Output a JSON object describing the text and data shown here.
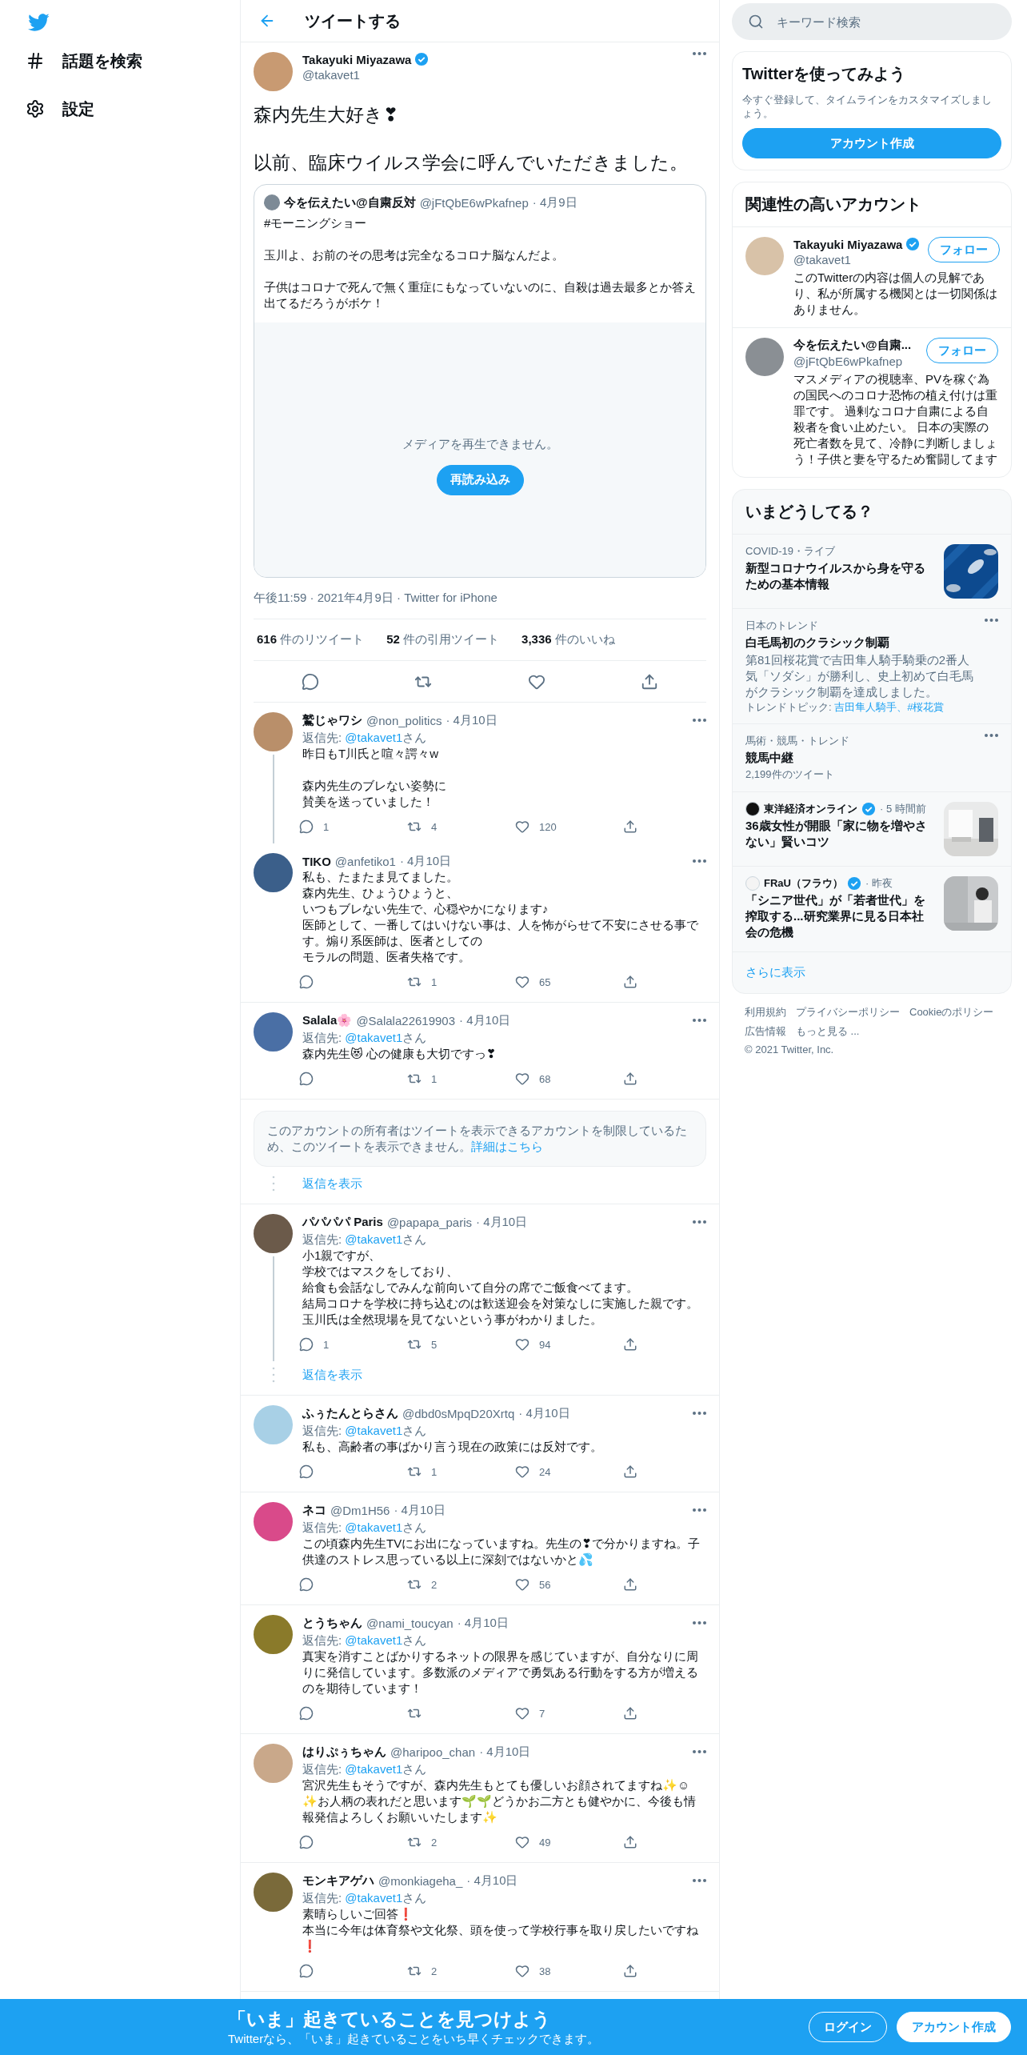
{
  "nav": {
    "items": [
      {
        "kind": "hash",
        "label": "話題を検索"
      },
      {
        "kind": "gear",
        "label": "設定"
      }
    ]
  },
  "header": {
    "title": "ツイートする"
  },
  "tweet": {
    "name": "Takayuki Miyazawa",
    "verified": true,
    "handle": "@takavet1",
    "text": [
      [
        "森内先生大好き❣"
      ],
      [
        "以前、臨床ウイルス学会に呼んでいただきました。"
      ]
    ],
    "quote": {
      "name": "今を伝えたい@自粛反対",
      "handle": "@jFtQbE6wPkafnep",
      "date": "· 4月9日",
      "text": [
        [
          "#モーニングショー"
        ],
        [
          "玉川よ、お前のその思考は完全なるコロナ脳なんだよ。"
        ],
        [
          "子供はコロナで死んで無く重症にもなっていないのに、自殺は過去最多とか答え出てるだろうがボケ！"
        ]
      ],
      "media_message": "メディアを再生できません。",
      "reload_button": "再読み込み"
    },
    "meta": "午後11:59 · 2021年4月9日 · Twitter for iPhone",
    "stats": [
      {
        "count": "616",
        "label": "件のリツイート"
      },
      {
        "count": "52",
        "label": "件の引用ツイート"
      },
      {
        "count": "3,336",
        "label": "件のいいね"
      }
    ]
  },
  "replies": [
    {
      "kind": "tweet",
      "name": "鷲じゃワシ",
      "handle": "@non_politics",
      "date": "· 4月10日",
      "reply_to": {
        "prefix": "返信先: ",
        "handle": "@takavet1",
        "suffix": "さん"
      },
      "text": [
        [
          "昨日もT川氏と喧々諤々w"
        ],
        [
          "森内先生のブレない姿勢に",
          "賛美を送っていました！"
        ]
      ],
      "replies": "1",
      "retweets": "4",
      "likes": "120",
      "thread": true
    },
    {
      "kind": "tweet",
      "name": "TIKO",
      "handle": "@anfetiko1",
      "date": "· 4月10日",
      "text": [
        [
          "私も、たまたま見てました。",
          "森内先生、ひょうひょうと、",
          "いつもブレない先生で、心穏やかになります♪",
          "医師として、一番してはいけない事は、人を怖がらせて不安にさせる事です。煽り系医師は、医者としての",
          "モラルの問題、医者失格です。"
        ]
      ],
      "retweets": "1",
      "likes": "65",
      "thread": false
    },
    {
      "kind": "tweet",
      "name": "Salala🌸",
      "handle": "@Salala22619903",
      "date": "· 4月10日",
      "reply_to": {
        "prefix": "返信先: ",
        "handle": "@takavet1",
        "suffix": "さん"
      },
      "text": [
        [
          "森内先生😻 心の健康も大切ですっ❣"
        ]
      ],
      "retweets": "1",
      "likes": "68",
      "thread": false
    },
    {
      "kind": "notice",
      "text": "このアカウントの所有者はツイートを表示できるアカウントを制限しているため、このツイートを表示できません。",
      "link": "詳細はこちら"
    },
    {
      "kind": "show_replies",
      "label": "返信を表示"
    },
    {
      "kind": "tweet",
      "name": "パパパパ Paris",
      "handle": "@papapa_paris",
      "date": "· 4月10日",
      "reply_to": {
        "prefix": "返信先: ",
        "handle": "@takavet1",
        "suffix": "さん"
      },
      "text": [
        [
          "小1親ですが、",
          "学校ではマスクをしており、",
          "給食も会話なしでみんな前向いて自分の席でご飯食べてます。",
          "結局コロナを学校に持ち込むのは歓送迎会を対策なしに実施した親です。",
          "玉川氏は全然現場を見てないという事がわかりました。"
        ]
      ],
      "replies": "1",
      "retweets": "5",
      "likes": "94",
      "thread": true
    },
    {
      "kind": "show_replies",
      "label": "返信を表示"
    },
    {
      "kind": "tweet",
      "name": "ふぅたんとらさん",
      "handle": "@dbd0sMpqD20Xrtq",
      "date": "· 4月10日",
      "reply_to": {
        "prefix": "返信先: ",
        "handle": "@takavet1",
        "suffix": "さん"
      },
      "text": [
        [
          "私も、高齢者の事ばかり言う現在の政策には反対です。"
        ]
      ],
      "retweets": "1",
      "likes": "24",
      "thread": false
    },
    {
      "kind": "tweet",
      "name": "ネコ",
      "handle": "@Dm1H56",
      "date": "· 4月10日",
      "reply_to": {
        "prefix": "返信先: ",
        "handle": "@takavet1",
        "suffix": "さん"
      },
      "text": [
        [
          "この頃森内先生TVにお出になっていますね。先生の❣で分かりますね。子供達のストレス思っている以上に深刻ではないかと💦"
        ]
      ],
      "retweets": "2",
      "likes": "56",
      "thread": false
    },
    {
      "kind": "tweet",
      "name": "とうちゃん",
      "handle": "@nami_toucyan",
      "date": "· 4月10日",
      "reply_to": {
        "prefix": "返信先: ",
        "handle": "@takavet1",
        "suffix": "さん"
      },
      "text": [
        [
          "真実を消すことばかりするネットの限界を感じていますが、自分なりに周りに発信しています。多数派のメディアで勇気ある行動をする方が増えるのを期待しています！"
        ]
      ],
      "likes": "7",
      "thread": false
    },
    {
      "kind": "tweet",
      "name": "はりぷぅちゃん",
      "handle": "@haripoo_chan",
      "date": "· 4月10日",
      "reply_to": {
        "prefix": "返信先: ",
        "handle": "@takavet1",
        "suffix": "さん"
      },
      "text": [
        [
          "宮沢先生もそうですが、森内先生もとても優しいお顔されてますね✨☺",
          "✨お人柄の表れだと思います🌱🌱どうかお二方とも健やかに、今後も情報発信よろしくお願いいたします✨"
        ]
      ],
      "retweets": "2",
      "likes": "49",
      "thread": false
    },
    {
      "kind": "tweet",
      "name": "モンキアゲハ",
      "handle": "@monkiageha_",
      "date": "· 4月10日",
      "reply_to": {
        "prefix": "返信先: ",
        "handle": "@takavet1",
        "suffix": "さん"
      },
      "text": [
        [
          "素晴らしいご回答❗",
          "本当に今年は体育祭や文化祭、頭を使って学校行事を取り戻したいですね❗"
        ]
      ],
      "retweets": "2",
      "likes": "38",
      "thread": false
    }
  ],
  "sidebar": {
    "search": {
      "placeholder": "キーワード検索"
    },
    "signup": {
      "title": "Twitterを使ってみよう",
      "text": "今すぐ登録して、タイムラインをカスタマイズしましょう。",
      "button": "アカウント作成"
    },
    "related": {
      "title": "関連性の高いアカウント",
      "accounts": [
        {
          "name": "Takayuki Miyazawa",
          "verified": true,
          "handle": "@takavet1",
          "bio": "このTwitterの内容は個人の見解であり、私が所属する機関とは一切関係はありません。",
          "button": "フォロー"
        },
        {
          "name": "今を伝えたい@自粛...",
          "handle": "@jFtQbE6wPkafnep",
          "bio": "マスメディアの視聴率、PVを稼ぐ為の国民へのコロナ恐怖の植え付けは重罪です。 過剰なコロナ自粛による自殺者を食い止めたい。 日本の実際の死亡者数を見て、冷静に判断しましょう！子供と妻を守るため奮闘してます",
          "button": "フォロー"
        }
      ]
    },
    "trends": {
      "title": "いまどうしてる？",
      "items": [
        {
          "kind": "news",
          "context": "COVID-19・ライブ",
          "title": "新型コロナウイルスから身を守るための基本情報"
        },
        {
          "kind": "trend",
          "context": "日本のトレンド",
          "title": "白毛馬初のクラシック制覇",
          "description": "第81回桜花賞で吉田隼人騎手騎乗の2番人気「ソダシ」が勝利し、史上初めて白毛馬がクラシック制覇を達成しました。",
          "topics_label": "トレンドトピック: ",
          "topics": "吉田隼人騎手、#桜花賞"
        },
        {
          "kind": "trend",
          "context": "馬術・競馬・トレンド",
          "title": "競馬中継",
          "count": "2,199件のツイート"
        },
        {
          "kind": "article",
          "source": "東洋経済オンライン",
          "verified": true,
          "time": "· 5 時間前",
          "title": "36歳女性が開眼「家に物を増やさない」賢いコツ"
        },
        {
          "kind": "article",
          "source": "FRaU（フラウ）",
          "verified": true,
          "time": "· 昨夜",
          "title": "「シニア世代」が「若者世代」を搾取する...研究業界に見る日本社会の危機"
        }
      ],
      "more": "さらに表示"
    },
    "footer": {
      "links": [
        "利用規約",
        "プライバシーポリシー",
        "Cookieのポリシー",
        "広告情報",
        "もっと見る ..."
      ],
      "copyright": "© 2021 Twitter, Inc."
    }
  },
  "bottom_bar": {
    "title": "「いま」起きていることを見つけよう",
    "subtitle": "Twitterなら、「いま」起きていることをいち早くチェックできます。",
    "login": "ログイン",
    "signup": "アカウント作成"
  }
}
